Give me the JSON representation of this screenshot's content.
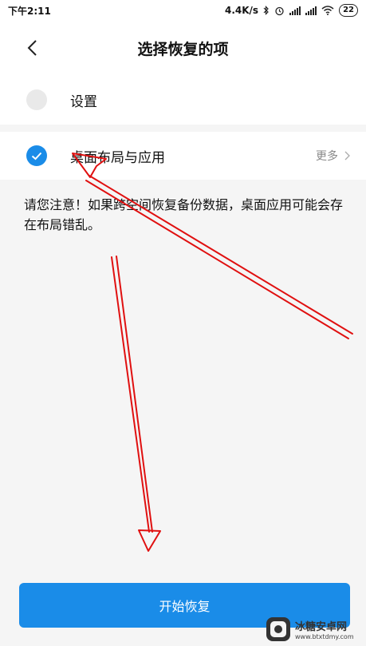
{
  "status_bar": {
    "time": "下午2:11",
    "speed": "4.4K/s",
    "battery": "22"
  },
  "header": {
    "title": "选择恢复的项"
  },
  "items": [
    {
      "label": "设置",
      "checked": false
    },
    {
      "label": "桌面布局与应用",
      "checked": true,
      "more_label": "更多"
    }
  ],
  "notice": "请您注意！如果跨空间恢复备份数据，桌面应用可能会存在布局错乱。",
  "start_button": "开始恢复",
  "watermark": {
    "name": "冰糖安卓网",
    "url": "www.btxtdmy.com"
  },
  "colors": {
    "accent": "#1a8ce8",
    "annotation": "#e01010"
  }
}
